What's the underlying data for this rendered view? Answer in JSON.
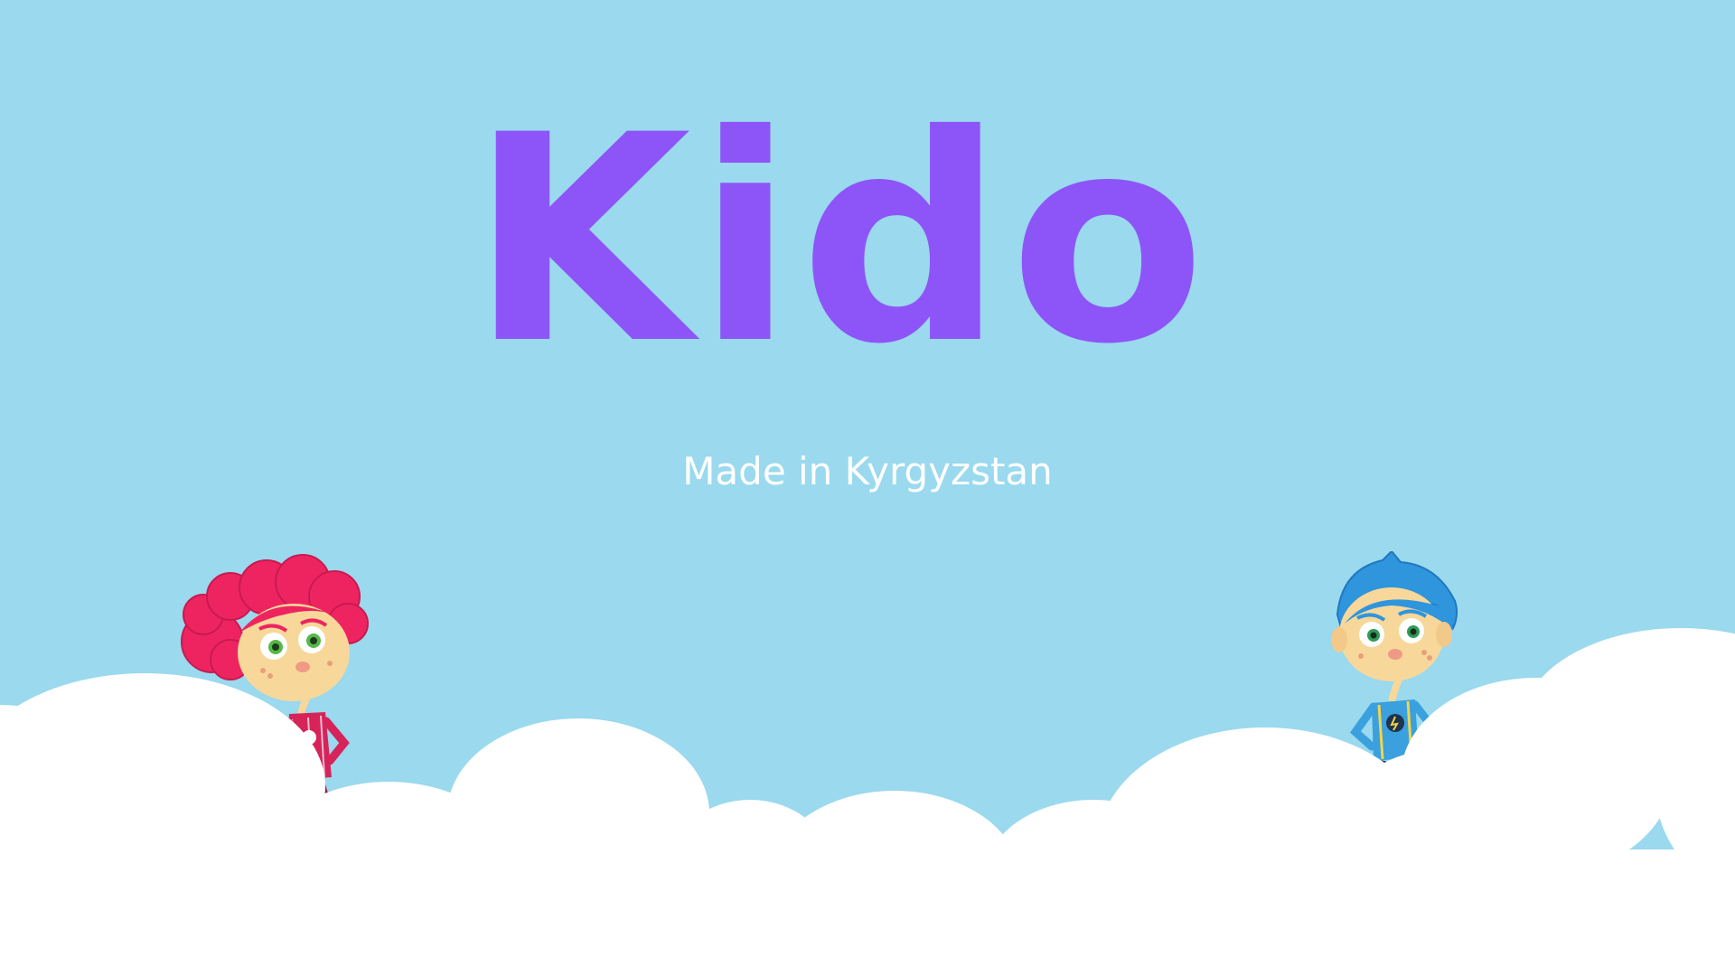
{
  "app": {
    "title": "Kido",
    "subtitle": "Made in Kyrgyzstan"
  },
  "theme": {
    "sky_color": "#9ad9ee",
    "title_color": "#8d55f7",
    "subtitle_color": "#ffffff",
    "cloud_color": "#ffffff"
  },
  "characters": [
    {
      "name": "girl-character",
      "hair_color": "#ee2460",
      "outfit_color": "#d6245a"
    },
    {
      "name": "boy-character",
      "hair_color": "#2f95dd",
      "outfit_color": "#3aa0de"
    }
  ]
}
